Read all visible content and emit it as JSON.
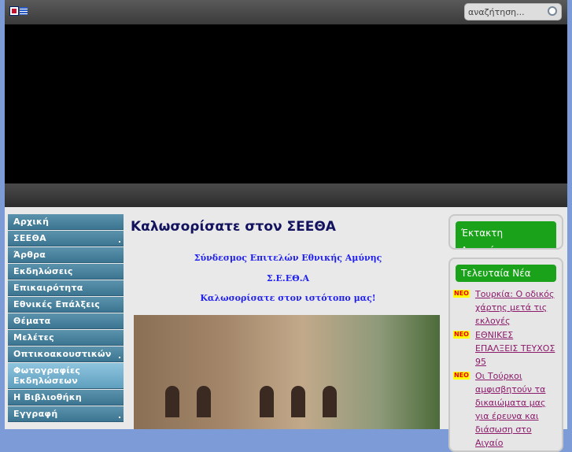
{
  "header": {
    "search_placeholder": "αναζήτηση..."
  },
  "menu": [
    {
      "label": "Αρχική",
      "sub": false
    },
    {
      "label": "ΣΕΕΘΑ",
      "sub": true
    },
    {
      "label": "Άρθρα",
      "sub": false
    },
    {
      "label": "Εκδηλώσεις",
      "sub": false
    },
    {
      "label": "Επικαιρότητα",
      "sub": false
    },
    {
      "label": "Εθνικές Επάλξεις",
      "sub": false
    },
    {
      "label": "Θέματα",
      "sub": false
    },
    {
      "label": "Μελέτες",
      "sub": false
    },
    {
      "label": "Οπτικοακουστικών",
      "sub": true
    },
    {
      "label": "Φωτογραφίες Εκδηλώσεων",
      "sub": false
    },
    {
      "label": "Η Βιβλιοθήκη",
      "sub": false
    },
    {
      "label": "Εγγραφή",
      "sub": true
    }
  ],
  "main": {
    "title": "Καλωσορίσατε στον ΣΕΕΘΑ",
    "line1": "Σύνδεσμος Επιτελών Εθνικής Αμύνης",
    "line2": "Σ.Ε.ΕΘ.Α",
    "line3": "Καλωσορίσατε στον ιστότοπο μας!"
  },
  "sidebar": {
    "announcement_title": "Έκτακτη Ανακοίνωση",
    "news_title": "Τελευταία Νέα",
    "badge": "NEO",
    "news": [
      "Τουρκία: Ο οδικός χάρτης μετά τις εκλογές",
      "ΕΘΝΙΚΕΣ ΕΠΑΛΞΕΙΣ ΤΕΥΧΟΣ 95",
      "Οι Τούρκοι αμφισβητούν τα δικαιώματα μας για έρευνα και διάσωση στο Αιγαίο"
    ]
  }
}
